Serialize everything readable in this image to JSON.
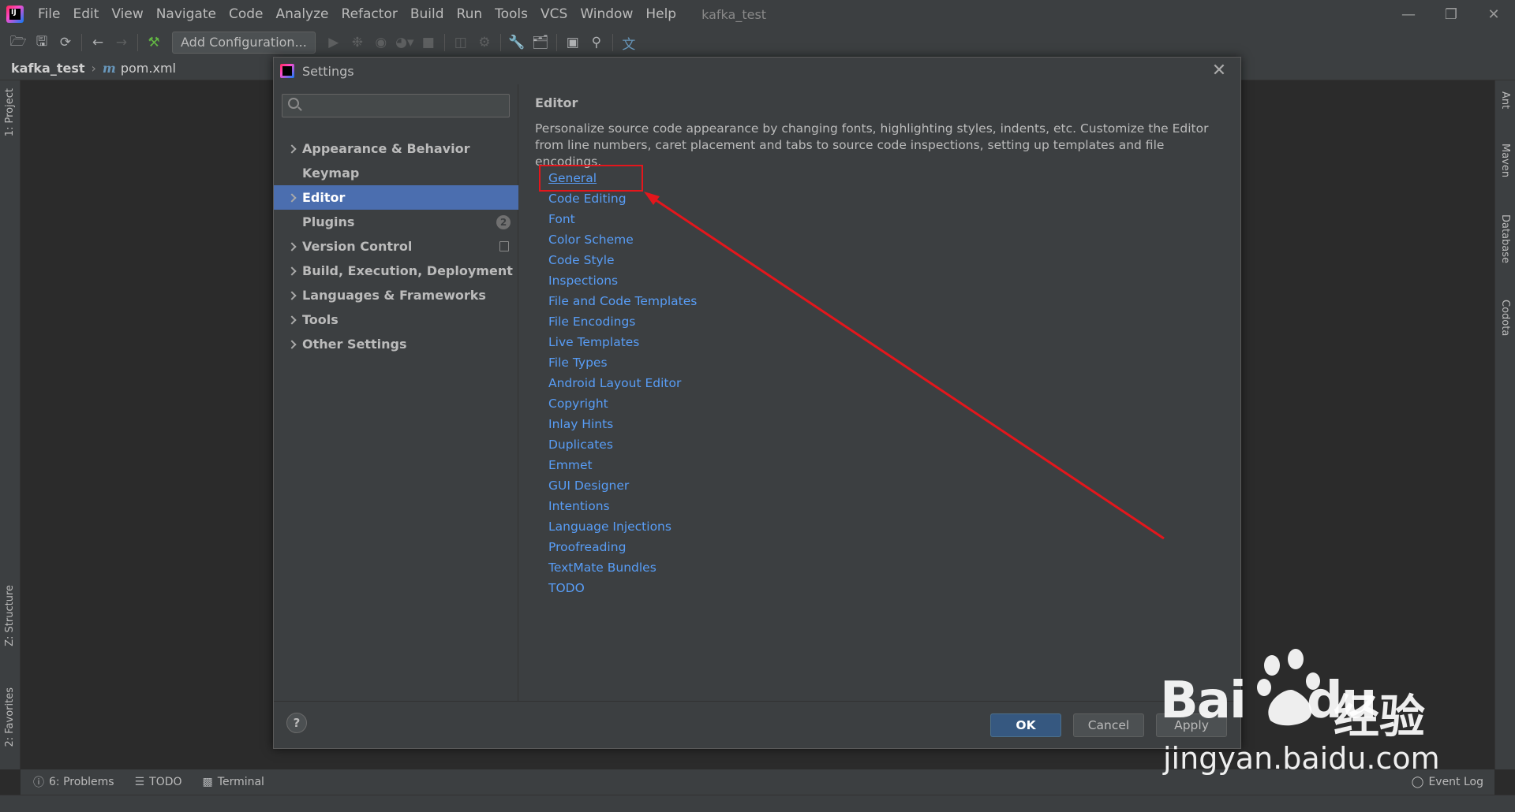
{
  "menubar": {
    "items": [
      "File",
      "Edit",
      "View",
      "Navigate",
      "Code",
      "Analyze",
      "Refactor",
      "Build",
      "Run",
      "Tools",
      "VCS",
      "Window",
      "Help"
    ],
    "window_title": "kafka_test"
  },
  "toolbar": {
    "add_config_label": "Add Configuration..."
  },
  "breadcrumb": {
    "project": "kafka_test",
    "file": "pom.xml"
  },
  "left_stripe": {
    "project_tab": "1: Project",
    "structure_tab": "Z: Structure",
    "favorites_tab": "2: Favorites"
  },
  "right_stripe": {
    "ant_tab": "Ant",
    "maven_tab": "Maven",
    "database_tab": "Database",
    "codota_tab": "Codota"
  },
  "tool_tabs": {
    "problems": "6: Problems",
    "todo": "TODO",
    "terminal": "Terminal",
    "event_log": "Event Log"
  },
  "dialog": {
    "title": "Settings",
    "search": {
      "value": "",
      "placeholder": ""
    },
    "tree": [
      {
        "label": "Appearance & Behavior",
        "expandable": true
      },
      {
        "label": "Keymap",
        "expandable": false
      },
      {
        "label": "Editor",
        "expandable": true,
        "selected": true
      },
      {
        "label": "Plugins",
        "expandable": false,
        "badge": "2"
      },
      {
        "label": "Version Control",
        "expandable": true
      },
      {
        "label": "Build, Execution, Deployment",
        "expandable": true
      },
      {
        "label": "Languages & Frameworks",
        "expandable": true
      },
      {
        "label": "Tools",
        "expandable": true
      },
      {
        "label": "Other Settings",
        "expandable": true
      }
    ],
    "content": {
      "title": "Editor",
      "description": "Personalize source code appearance by changing fonts, highlighting styles, indents, etc. Customize the Editor from line numbers, caret placement and tabs to source code inspections, setting up templates and file encodings.",
      "links": [
        "General",
        "Code Editing",
        "Font",
        "Color Scheme",
        "Code Style",
        "Inspections",
        "File and Code Templates",
        "File Encodings",
        "Live Templates",
        "File Types",
        "Android Layout Editor",
        "Copyright",
        "Inlay Hints",
        "Duplicates",
        "Emmet",
        "GUI Designer",
        "Intentions",
        "Language Injections",
        "Proofreading",
        "TextMate Bundles",
        "TODO"
      ]
    },
    "buttons": {
      "help": "?",
      "ok": "OK",
      "cancel": "Cancel",
      "apply": "Apply"
    }
  },
  "watermark": {
    "brand": "Bai",
    "brand_du": "du",
    "product": "经验",
    "url": "jingyan.baidu.com"
  },
  "colors": {
    "link": "#589df6",
    "selection": "#4b6eaf",
    "annotation": "#e4161c",
    "ok_button": "#365880"
  }
}
